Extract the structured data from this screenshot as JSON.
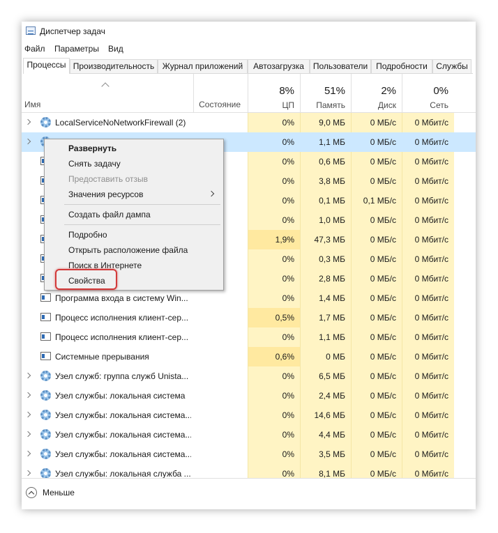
{
  "window": {
    "title": "Диспетчер задач"
  },
  "menu": [
    "Файл",
    "Параметры",
    "Вид"
  ],
  "tabs": [
    "Процессы",
    "Производительность",
    "Журнал приложений",
    "Автозагрузка",
    "Пользователи",
    "Подробности",
    "Службы"
  ],
  "active_tab": "Процессы",
  "columns": {
    "name": "Имя",
    "state": "Состояние",
    "cpu": {
      "pct": "8%",
      "label": "ЦП"
    },
    "mem": {
      "pct": "51%",
      "label": "Память"
    },
    "disk": {
      "pct": "2%",
      "label": "Диск"
    },
    "net": {
      "pct": "0%",
      "label": "Сеть"
    }
  },
  "rows": [
    {
      "name": "LocalServiceNoNetworkFirewall (2)",
      "expand": true,
      "icon": "gear-icon",
      "cpu": "0%",
      "mem": "9,0 МБ",
      "disk": "0 МБ/с",
      "net": "0 Мбит/с"
    },
    {
      "name": "",
      "expand": true,
      "icon": "gear-icon",
      "cpu": "0%",
      "mem": "1,1 МБ",
      "disk": "0 МБ/с",
      "net": "0 Мбит/с",
      "selected": true
    },
    {
      "name": "",
      "expand": false,
      "icon": "window-icon",
      "cpu": "0%",
      "mem": "0,6 МБ",
      "disk": "0 МБ/с",
      "net": "0 Мбит/с"
    },
    {
      "name": "",
      "expand": false,
      "icon": "window-icon",
      "cpu": "0%",
      "mem": "3,8 МБ",
      "disk": "0 МБ/с",
      "net": "0 Мбит/с"
    },
    {
      "name": "",
      "expand": false,
      "icon": "window-icon",
      "cpu": "0%",
      "mem": "0,1 МБ",
      "disk": "0,1 МБ/с",
      "net": "0 Мбит/с"
    },
    {
      "name": "",
      "expand": false,
      "icon": "window-icon",
      "cpu": "0%",
      "mem": "1,0 МБ",
      "disk": "0 МБ/с",
      "net": "0 Мбит/с"
    },
    {
      "name": "",
      "expand": false,
      "icon": "window-icon",
      "cpu": "1,9%",
      "mem": "47,3 МБ",
      "disk": "0 МБ/с",
      "net": "0 Мбит/с"
    },
    {
      "name": "",
      "expand": false,
      "icon": "window-icon",
      "cpu": "0%",
      "mem": "0,3 МБ",
      "disk": "0 МБ/с",
      "net": "0 Мбит/с"
    },
    {
      "name": "",
      "expand": false,
      "icon": "window-icon",
      "cpu": "0%",
      "mem": "2,8 МБ",
      "disk": "0 МБ/с",
      "net": "0 Мбит/с"
    },
    {
      "name": "Программа входа в систему Win...",
      "expand": false,
      "icon": "window-icon",
      "cpu": "0%",
      "mem": "1,4 МБ",
      "disk": "0 МБ/с",
      "net": "0 Мбит/с"
    },
    {
      "name": "Процесс исполнения клиент-сер...",
      "expand": false,
      "icon": "window-icon",
      "cpu": "0,5%",
      "mem": "1,7 МБ",
      "disk": "0 МБ/с",
      "net": "0 Мбит/с"
    },
    {
      "name": "Процесс исполнения клиент-сер...",
      "expand": false,
      "icon": "window-icon",
      "cpu": "0%",
      "mem": "1,1 МБ",
      "disk": "0 МБ/с",
      "net": "0 Мбит/с"
    },
    {
      "name": "Системные прерывания",
      "expand": false,
      "icon": "window-icon",
      "cpu": "0,6%",
      "mem": "0 МБ",
      "disk": "0 МБ/с",
      "net": "0 Мбит/с"
    },
    {
      "name": "Узел служб: группа служб Unista...",
      "expand": true,
      "icon": "gear-icon",
      "cpu": "0%",
      "mem": "6,5 МБ",
      "disk": "0 МБ/с",
      "net": "0 Мбит/с"
    },
    {
      "name": "Узел службы: локальная система",
      "expand": true,
      "icon": "gear-icon",
      "cpu": "0%",
      "mem": "2,4 МБ",
      "disk": "0 МБ/с",
      "net": "0 Мбит/с"
    },
    {
      "name": "Узел службы: локальная система...",
      "expand": true,
      "icon": "gear-icon",
      "cpu": "0%",
      "mem": "14,6 МБ",
      "disk": "0 МБ/с",
      "net": "0 Мбит/с"
    },
    {
      "name": "Узел службы: локальная система...",
      "expand": true,
      "icon": "gear-icon",
      "cpu": "0%",
      "mem": "4,4 МБ",
      "disk": "0 МБ/с",
      "net": "0 Мбит/с"
    },
    {
      "name": "Узел службы: локальная система...",
      "expand": true,
      "icon": "gear-icon",
      "cpu": "0%",
      "mem": "3,5 МБ",
      "disk": "0 МБ/с",
      "net": "0 Мбит/с"
    },
    {
      "name": "Узел службы: локальная служба ...",
      "expand": true,
      "icon": "gear-icon",
      "cpu": "0%",
      "mem": "8,1 МБ",
      "disk": "0 МБ/с",
      "net": "0 Мбит/с"
    }
  ],
  "context_menu": {
    "expand": "Развернуть",
    "end_task": "Снять задачу",
    "feedback": "Предоставить отзыв",
    "resource_values": "Значения ресурсов",
    "create_dump": "Создать файл дампа",
    "details": "Подробно",
    "open_location": "Открыть расположение файла",
    "search_online": "Поиск в Интернете",
    "properties": "Свойства"
  },
  "footer": {
    "less": "Меньше"
  },
  "colors": {
    "cell": "#fff4c4",
    "selected": "#cce8ff",
    "highlight": "#d33a3a"
  }
}
